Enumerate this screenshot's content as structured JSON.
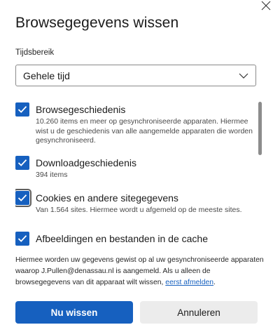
{
  "dialog": {
    "title": "Browsegegevens wissen",
    "close_icon": "close-icon"
  },
  "time_range": {
    "label": "Tijdsbereik",
    "selected": "Gehele tijd",
    "chevron_icon": "chevron-down-icon"
  },
  "items": [
    {
      "label": "Browsegeschiedenis",
      "checked": true,
      "description": "10.260 items en meer op gesynchroniseerde apparaten. Hiermee wist u de geschiedenis van alle aangemelde apparaten die worden gesynchroniseerd."
    },
    {
      "label": "Downloadgeschiedenis",
      "checked": true,
      "description": "394 items"
    },
    {
      "label": "Cookies en andere sitegegevens",
      "checked": true,
      "description": "Van 1.564 sites. Hiermee wordt u afgemeld op de meeste sites."
    },
    {
      "label": "Afbeeldingen en bestanden in de cache",
      "checked": true,
      "description": ""
    }
  ],
  "footer": {
    "text": "Hiermee worden uw gegevens gewist op al uw gesynchroniseerde apparaten waarop J.Pullen@denassau.nl is aangemeld. Als u alleen de browsegegevens van dit apparaat wilt wissen, ",
    "link": "eerst afmelden",
    "suffix": "."
  },
  "buttons": {
    "primary": "Nu wissen",
    "secondary": "Annuleren"
  },
  "colors": {
    "accent": "#1660bf",
    "secondary_button": "#ececec"
  }
}
